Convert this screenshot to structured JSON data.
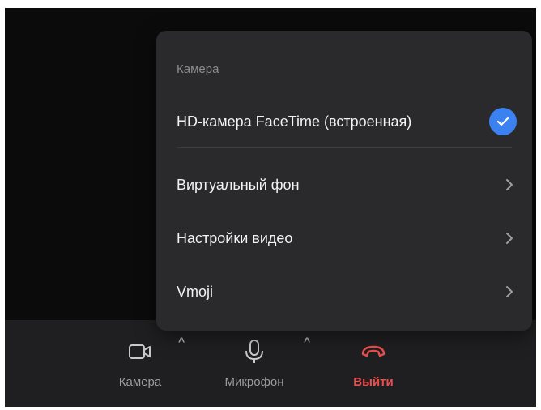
{
  "menu": {
    "section_title": "Камера",
    "camera_device": "HD-камера FaceTime (встроенная)",
    "camera_selected": true,
    "items": [
      {
        "label": "Виртуальный фон"
      },
      {
        "label": "Настройки видео"
      },
      {
        "label": "Vmoji"
      }
    ]
  },
  "toolbar": {
    "camera_label": "Камера",
    "mic_label": "Микрофон",
    "exit_label": "Выйти"
  },
  "colors": {
    "accent": "#3b82f0",
    "exit": "#ea4e4e",
    "menu_bg": "#2a2a2c",
    "toolbar_bg": "#1f1f21"
  }
}
